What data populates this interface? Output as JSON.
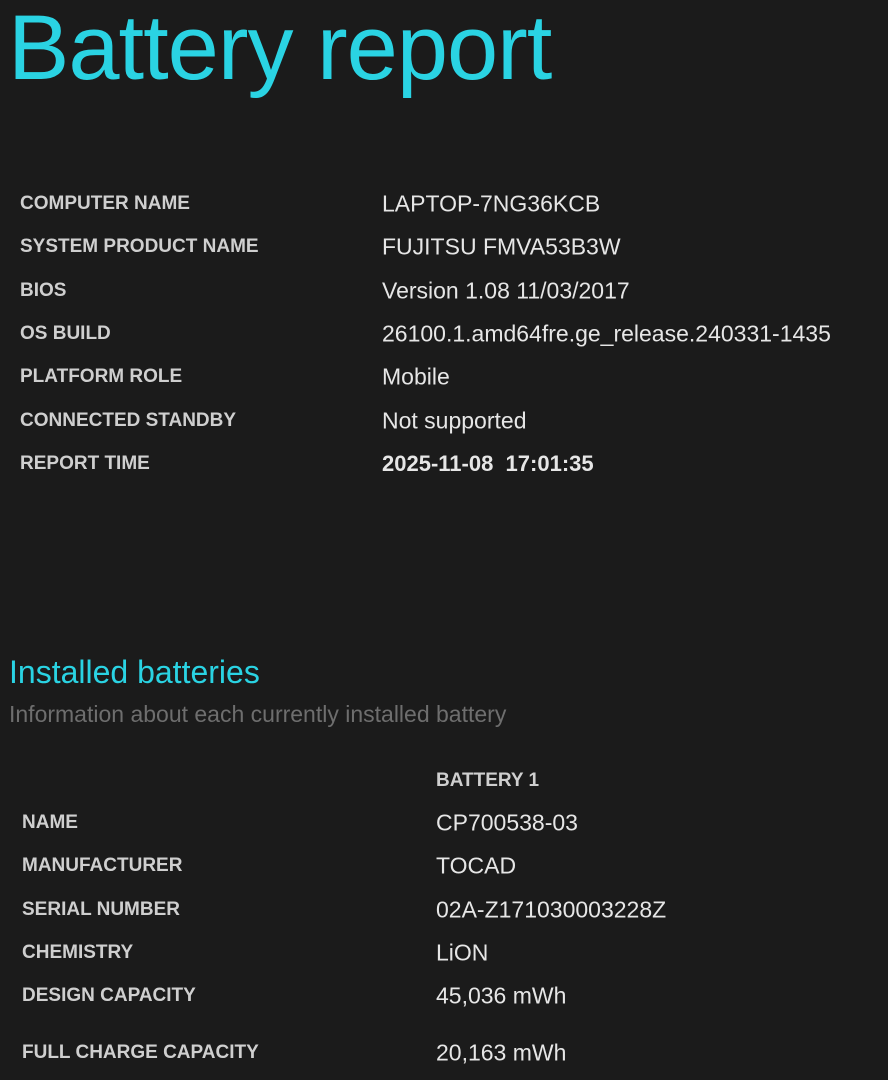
{
  "title": "Battery report",
  "system_info": [
    {
      "label": "COMPUTER NAME",
      "value": "LAPTOP-7NG36KCB"
    },
    {
      "label": "SYSTEM PRODUCT NAME",
      "value": "FUJITSU FMVA53B3W"
    },
    {
      "label": "BIOS",
      "value": "Version 1.08 11/03/2017"
    },
    {
      "label": "OS BUILD",
      "value": "26100.1.amd64fre.ge_release.240331-1435"
    },
    {
      "label": "PLATFORM ROLE",
      "value": "Mobile"
    },
    {
      "label": "CONNECTED STANDBY",
      "value": "Not supported"
    },
    {
      "label": "REPORT TIME",
      "value": "2025-11-08  17:01:35"
    }
  ],
  "installed_batteries": {
    "heading": "Installed batteries",
    "subtitle": "Information about each currently installed battery",
    "column_header": "BATTERY 1",
    "rows": [
      {
        "label": "NAME",
        "value": "CP700538-03"
      },
      {
        "label": "MANUFACTURER",
        "value": "TOCAD"
      },
      {
        "label": "SERIAL NUMBER",
        "value": "02A-Z171030003228Z"
      },
      {
        "label": "CHEMISTRY",
        "value": "LiON"
      },
      {
        "label": "DESIGN CAPACITY",
        "value": "45,036 mWh"
      },
      {
        "label": "FULL CHARGE CAPACITY",
        "value": "20,163 mWh"
      }
    ]
  }
}
